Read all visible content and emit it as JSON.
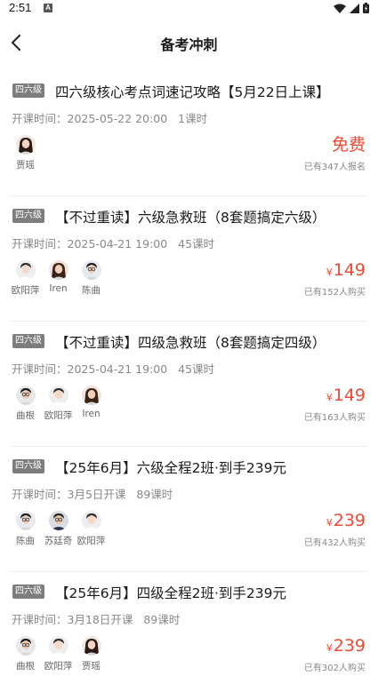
{
  "status": {
    "time": "2:51",
    "notif": "A"
  },
  "nav": {
    "title": "备考冲刺"
  },
  "courses": [
    {
      "tag": "四六级",
      "title": "四六级核心考点词速记攻略【5月22日上课】",
      "time_label": "开课时间：2025-05-22 20:00",
      "lessons": "1课时",
      "teachers": [
        "贾瑶"
      ],
      "price_symbol": "",
      "price": "免费",
      "enroll": "已有347人报名"
    },
    {
      "tag": "四六级",
      "title": "【不过重读】六级急救班（8套题搞定六级）",
      "time_label": "开课时间：2025-04-21 19:00",
      "lessons": "45课时",
      "teachers": [
        "欧阳萍",
        "Iren",
        "陈曲"
      ],
      "price_symbol": "¥",
      "price": "149",
      "enroll": "已有152人购买"
    },
    {
      "tag": "四六级",
      "title": "【不过重读】四级急救班（8套题搞定四级）",
      "time_label": "开课时间：2025-04-21 19:00",
      "lessons": "45课时",
      "teachers": [
        "曲根",
        "欧阳萍",
        "Iren"
      ],
      "price_symbol": "¥",
      "price": "149",
      "enroll": "已有163人购买"
    },
    {
      "tag": "四六级",
      "title": "【25年6月】六级全程2班·到手239元",
      "time_label": "开课时间：3月5日开课",
      "lessons": "89课时",
      "teachers": [
        "陈曲",
        "苏廷奇",
        "欧阳萍"
      ],
      "price_symbol": "¥",
      "price": "239",
      "enroll": "已有432人购买"
    },
    {
      "tag": "四六级",
      "title": "【25年6月】四级全程2班·到手239元",
      "time_label": "开课时间：3月18日开课",
      "lessons": "89课时",
      "teachers": [
        "曲根",
        "欧阳萍",
        "贾瑶"
      ],
      "price_symbol": "¥",
      "price": "239",
      "enroll": "已有302人购买"
    }
  ],
  "colors": {
    "price": "#f04a34",
    "tag_bg": "#7d7d7d",
    "meta": "#888888"
  }
}
